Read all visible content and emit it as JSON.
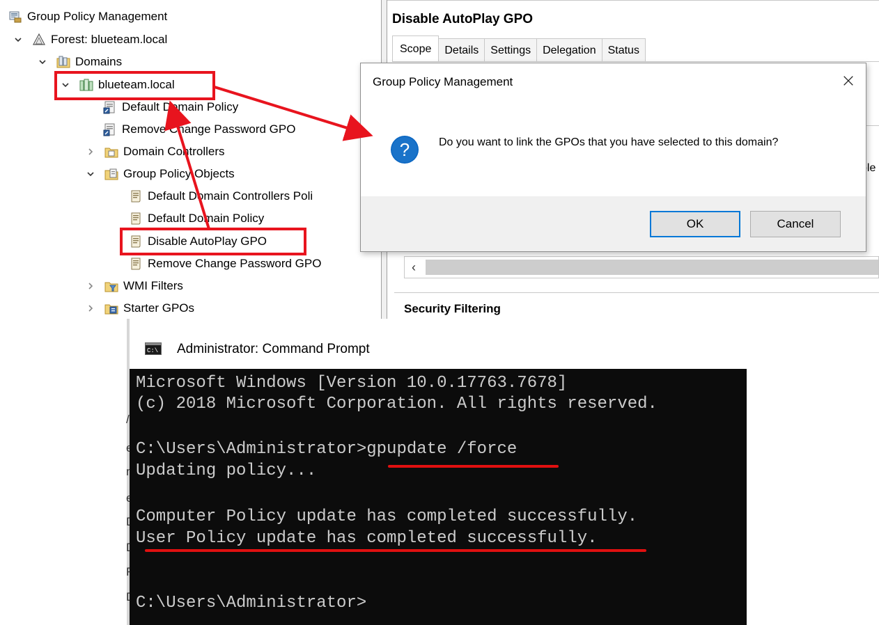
{
  "tree": {
    "items": [
      {
        "label": "Group Policy Management",
        "icon": "gpmc-icon",
        "chevron": "none"
      },
      {
        "label": "Forest: blueteam.local",
        "icon": "forest-icon",
        "chevron": "down"
      },
      {
        "label": "Domains",
        "icon": "domains-icon",
        "chevron": "down"
      },
      {
        "label": "blueteam.local",
        "icon": "domain-icon",
        "chevron": "down"
      },
      {
        "label": "Default Domain Policy",
        "icon": "gpo-link-icon",
        "chevron": "none"
      },
      {
        "label": "Remove Change Password GPO",
        "icon": "gpo-link-icon",
        "chevron": "none"
      },
      {
        "label": "Domain Controllers",
        "icon": "ou-icon",
        "chevron": "right"
      },
      {
        "label": "Group Policy Objects",
        "icon": "gpo-folder-icon",
        "chevron": "down"
      },
      {
        "label": "Default Domain Controllers Poli",
        "icon": "gpo-icon",
        "chevron": "none"
      },
      {
        "label": "Default Domain Policy",
        "icon": "gpo-icon",
        "chevron": "none"
      },
      {
        "label": "Disable AutoPlay GPO",
        "icon": "gpo-icon",
        "chevron": "none"
      },
      {
        "label": "Remove Change Password GPO",
        "icon": "gpo-icon",
        "chevron": "none"
      },
      {
        "label": "WMI Filters",
        "icon": "wmi-folder-icon",
        "chevron": "right"
      },
      {
        "label": "Starter GPOs",
        "icon": "starter-folder-icon",
        "chevron": "right"
      }
    ]
  },
  "gpo_pane": {
    "title": "Disable AutoPlay GPO",
    "tabs": [
      "Scope",
      "Details",
      "Settings",
      "Delegation",
      "Status"
    ],
    "active_tab": "Scope",
    "clipped_text": "ble",
    "section_heading": "Security Filtering"
  },
  "dialog": {
    "title": "Group Policy Management",
    "message": "Do you want to link the GPOs that you have selected to this domain?",
    "ok_label": "OK",
    "cancel_label": "Cancel"
  },
  "cmd": {
    "title": "Administrator: Command Prompt",
    "lines": [
      "Microsoft Windows [Version 10.0.17763.7678]",
      "(c) 2018 Microsoft Corporation. All rights reserved.",
      "",
      "C:\\Users\\Administrator>gpupdate /force",
      "Updating policy...",
      "",
      "Computer Policy update has completed successfully.",
      "User Policy update has completed successfully.",
      "",
      "",
      "C:\\Users\\Administrator>"
    ],
    "behind_glyphs": [
      "/",
      "e",
      "n",
      "e",
      "D",
      "D",
      "R",
      "D"
    ]
  },
  "colors": {
    "annotation_red": "#e8141e",
    "console_bg": "#0c0c0c",
    "console_text": "#cccccc",
    "focus_blue": "#0078d7",
    "question_icon": "#0a66c2"
  }
}
